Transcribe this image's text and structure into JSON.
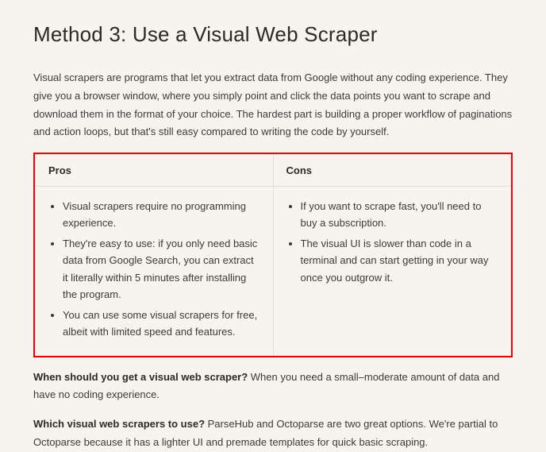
{
  "heading": "Method 3: Use a Visual Web Scraper",
  "intro": "Visual scrapers are programs that let you extract data from Google without any coding experience. They give you a browser window, where you simply point and click the data points you want to scrape and download them in the format of your choice. The hardest part is building a proper workflow of paginations and action loops, but that's still easy compared to writing the code by yourself.",
  "table": {
    "headers": {
      "pros": "Pros",
      "cons": "Cons"
    },
    "pros": [
      "Visual scrapers require no programming experience.",
      "They're easy to use: if you only need basic data from Google Search, you can extract it literally within 5 minutes after installing the program.",
      "You can use some visual scrapers for free, albeit with limited speed and features."
    ],
    "cons": [
      "If you want to scrape fast, you'll need to buy a subscription.",
      "The visual UI is slower than code in a terminal and can start getting in your way once you outgrow it."
    ]
  },
  "when": {
    "lead": "When should you get a visual web scraper?",
    "body": " When you need a small–moderate amount of data and have no coding experience."
  },
  "which": {
    "lead": "Which visual web scrapers to use?",
    "body": " ParseHub and Octoparse are two great options. We're partial to Octoparse because it has a lighter UI and premade templates for quick basic scraping."
  }
}
